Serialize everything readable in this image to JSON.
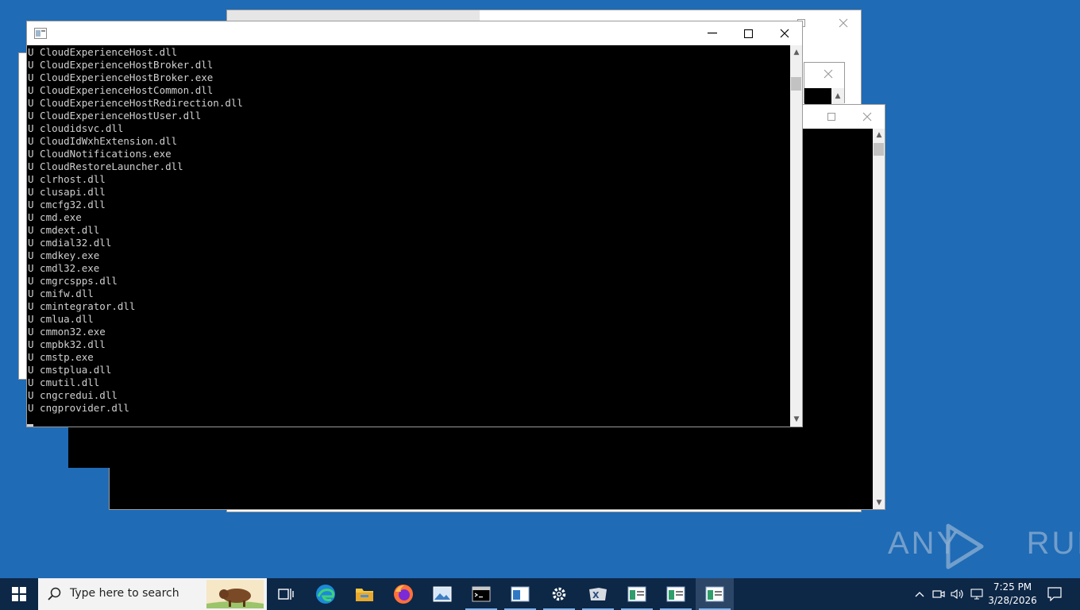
{
  "console_lines": [
    "U CloudExperienceHost.dll",
    "U CloudExperienceHostBroker.dll",
    "U CloudExperienceHostBroker.exe",
    "U CloudExperienceHostCommon.dll",
    "U CloudExperienceHostRedirection.dll",
    "U CloudExperienceHostUser.dll",
    "U cloudidsvc.dll",
    "U CloudIdWxhExtension.dll",
    "U CloudNotifications.exe",
    "U CloudRestoreLauncher.dll",
    "U clrhost.dll",
    "U clusapi.dll",
    "U cmcfg32.dll",
    "U cmd.exe",
    "U cmdext.dll",
    "U cmdial32.dll",
    "U cmdkey.exe",
    "U cmdl32.exe",
    "U cmgrcspps.dll",
    "U cmifw.dll",
    "U cmintegrator.dll",
    "U cmlua.dll",
    "U cmmon32.exe",
    "U cmpbk32.dll",
    "U cmstp.exe",
    "U cmstplua.dll",
    "U cmutil.dll",
    "U cngcredui.dll",
    "U cngprovider.dll"
  ],
  "taskbar": {
    "search_placeholder": "Type here to search",
    "time": "7:25 PM",
    "date": "3/28/2026"
  },
  "watermark": "ANY RUN",
  "colors": {
    "desktop": "#1f6bb5",
    "taskbar": "#0d2747",
    "console_bg": "#000000",
    "console_text": "#d0d0d0"
  }
}
